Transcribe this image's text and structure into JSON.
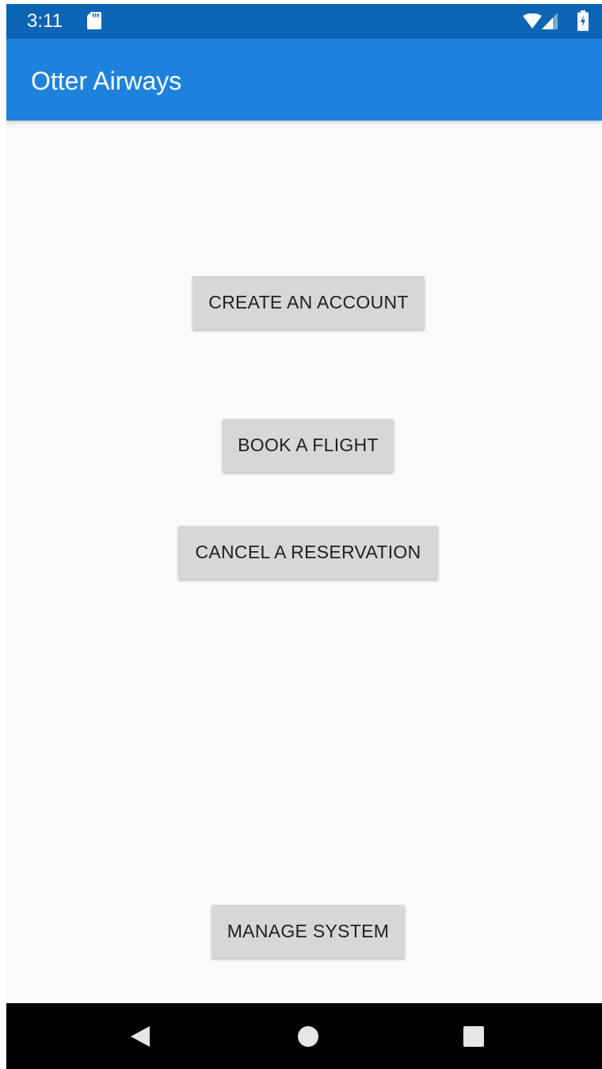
{
  "status_bar": {
    "time": "3:11",
    "icons": [
      "sd-card-icon",
      "wifi-icon",
      "signal-icon",
      "battery-charging-icon"
    ]
  },
  "app_bar": {
    "title": "Otter Airways"
  },
  "main": {
    "buttons": [
      {
        "label": "CREATE AN ACCOUNT"
      },
      {
        "label": "BOOK A FLIGHT"
      },
      {
        "label": "CANCEL A RESERVATION"
      },
      {
        "label": "MANAGE SYSTEM"
      }
    ]
  },
  "nav_bar": {
    "icons": [
      "back-icon",
      "home-icon",
      "recents-icon"
    ]
  },
  "colors": {
    "status_bar": "#0c64b4",
    "app_bar": "#1e82dc",
    "background": "#fafafa",
    "button": "#d7d7d7",
    "button_text": "#1f1f1f"
  }
}
